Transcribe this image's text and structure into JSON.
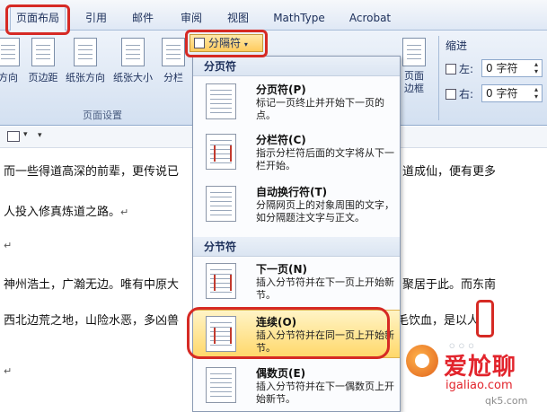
{
  "ribbon": {
    "tabs": [
      {
        "label": "页面布局",
        "active": true
      },
      {
        "label": "引用"
      },
      {
        "label": "邮件"
      },
      {
        "label": "审阅"
      },
      {
        "label": "视图"
      },
      {
        "label": "MathType"
      },
      {
        "label": "Acrobat"
      }
    ],
    "buttons": [
      {
        "label": "方向"
      },
      {
        "label": "页边距"
      },
      {
        "label": "纸张方向"
      },
      {
        "label": "纸张大小"
      },
      {
        "label": "分栏"
      }
    ],
    "breaks_button": "分隔符",
    "page_border": "页面\n边框",
    "page_setup_group": "页面设置",
    "indent": {
      "title": "缩进",
      "left_label": "左:",
      "left_value": "0 字符",
      "right_label": "右:",
      "right_value": "0 字符"
    }
  },
  "document": {
    "lines": [
      "而一些得道高深的前辈，更传说已",
      "道成仙，便有更多",
      "人投入修真炼道之路。",
      "神州浩土，广瀚无边。唯有中原大",
      "聚居于此。而东南",
      "西北边荒之地，山险水恶，多凶兽",
      "毛饮血，是以人"
    ],
    "paragraph_mark": "↵"
  },
  "menu": {
    "sections": [
      {
        "header": "分页符",
        "items": [
          {
            "title": "分页符(P)",
            "desc": "标记一页终止并开始下一页的点。"
          },
          {
            "title": "分栏符(C)",
            "desc": "指示分栏符后面的文字将从下一栏开始。"
          },
          {
            "title": "自动换行符(T)",
            "desc": "分隔网页上的对象周围的文字，如分隔题注文字与正文。"
          }
        ]
      },
      {
        "header": "分节符",
        "items": [
          {
            "title": "下一页(N)",
            "desc": "插入分节符并在下一页上开始新节。"
          },
          {
            "title": "连续(O)",
            "desc": "插入分节符并在同一页上开始新节。",
            "highlighted": true
          },
          {
            "title": "偶数页(E)",
            "desc": "插入分节符并在下一偶数页上开始新节。"
          }
        ]
      }
    ]
  },
  "watermark": {
    "text": "爱尬聊",
    "url": "igaliao.com",
    "url2": "qk5.com"
  }
}
